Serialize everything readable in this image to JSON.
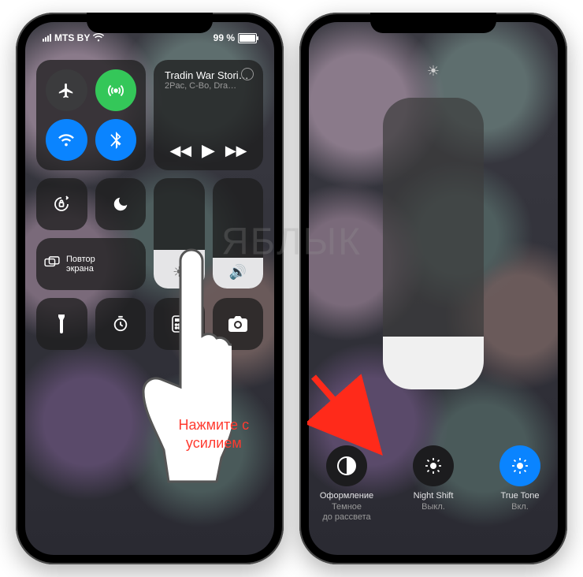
{
  "status": {
    "carrier": "MTS BY",
    "battery_pct": "99 %"
  },
  "media": {
    "title": "Tradin War Stori…",
    "subtitle": "2Pac, C-Bo, Dra…"
  },
  "mirror_label": "Повтор\nэкрана",
  "press_hint_line1": "Нажмите с",
  "press_hint_line2": "усилием",
  "options": {
    "dark": {
      "label": "Оформление",
      "sub1": "Темное",
      "sub2": "до рассвета"
    },
    "nightshift": {
      "label": "Night Shift",
      "sub": "Выкл."
    },
    "truetone": {
      "label": "True Tone",
      "sub": "Вкл."
    }
  },
  "watermark": "ЯБЛЫК"
}
